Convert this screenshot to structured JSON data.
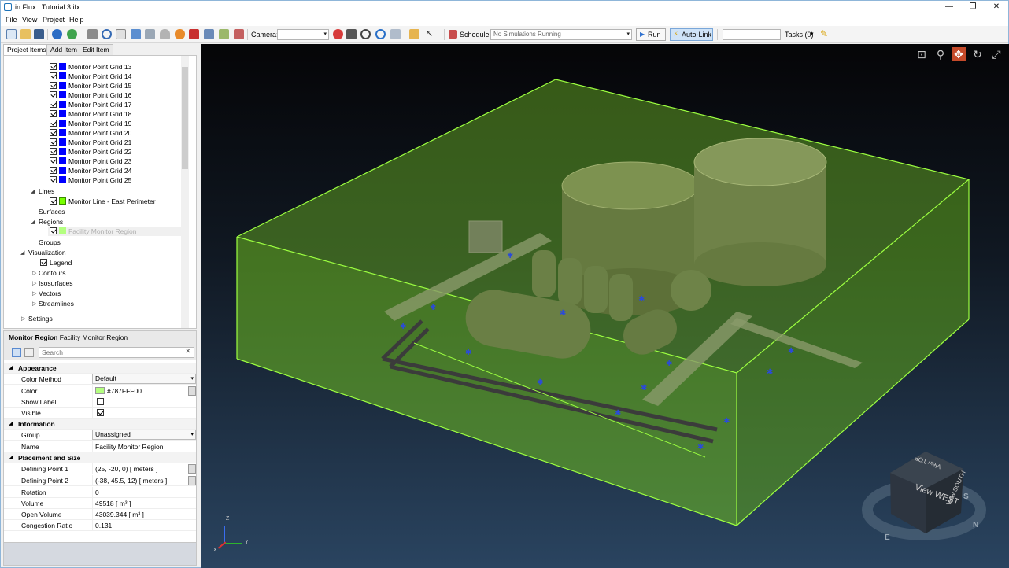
{
  "window": {
    "title": "in:Flux : Tutorial 3.ifx",
    "min": "—",
    "max": "❐",
    "close": "✕"
  },
  "menu": [
    "File",
    "View",
    "Project",
    "Help"
  ],
  "toolbar": {
    "camera_label": "Camera:",
    "schedule_label": "Schedule:",
    "schedule_value": "No Simulations Running",
    "run_label": "Run",
    "autolink_label": "Auto-Link",
    "tasks_label": "Tasks (0)"
  },
  "tabs": [
    "Project Items",
    "Add Item",
    "Edit Item"
  ],
  "tree": {
    "grids": [
      "Monitor Point Grid 13",
      "Monitor Point Grid 14",
      "Monitor Point Grid 15",
      "Monitor Point Grid 16",
      "Monitor Point Grid 17",
      "Monitor Point Grid 18",
      "Monitor Point Grid 19",
      "Monitor Point Grid 20",
      "Monitor Point Grid 21",
      "Monitor Point Grid 22",
      "Monitor Point Grid 23",
      "Monitor Point Grid 24",
      "Monitor Point Grid 25"
    ],
    "lines": "Lines",
    "line_item": "Monitor Line - East Perimeter",
    "surfaces": "Surfaces",
    "regions": "Regions",
    "region_item": "Facility Monitor Region",
    "groups": "Groups",
    "visualization": "Visualization",
    "legend": "Legend",
    "contours": "Contours",
    "isosurfaces": "Isosurfaces",
    "vectors": "Vectors",
    "streamlines": "Streamlines",
    "settings": "Settings",
    "grid_color": "#0000ff",
    "line_color": "#78ff00"
  },
  "props": {
    "type": "Monitor Region",
    "name": "Facility Monitor Region",
    "search_placeholder": "Search",
    "cat_appearance": "Appearance",
    "color_method_label": "Color Method",
    "color_method_value": "Default",
    "color_label": "Color",
    "color_value": "#787FFF00",
    "color_swatch": "#b4ff80",
    "show_label_label": "Show Label",
    "visible_label": "Visible",
    "cat_information": "Information",
    "group_label": "Group",
    "group_value": "Unassigned",
    "name_label": "Name",
    "name_value": "Facility Monitor Region",
    "cat_placement": "Placement and Size",
    "dp1_label": "Defining Point 1",
    "dp1_value": "(25, -20, 0) [ meters ]",
    "dp2_label": "Defining Point 2",
    "dp2_value": "(-38, 45.5, 12) [ meters ]",
    "rotation_label": "Rotation",
    "rotation_value": "0",
    "volume_label": "Volume",
    "volume_value": "49518 [ m³ ]",
    "open_volume_label": "Open Volume",
    "open_volume_value": "43039.344 [ m³ ]",
    "congestion_label": "Congestion Ratio",
    "congestion_value": "0.131"
  },
  "viewcube": {
    "face_left": "View WEST",
    "face_right": "View SOUTH",
    "face_top": "View TOP",
    "compass_n": "N",
    "compass_e": "E",
    "compass_s": "S"
  },
  "axes": {
    "z": "Z",
    "y": "Y",
    "x": "X"
  }
}
